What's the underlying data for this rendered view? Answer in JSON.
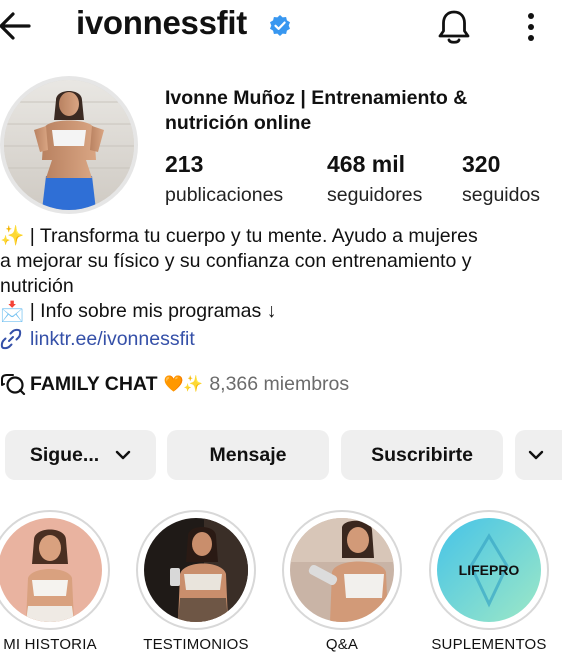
{
  "header": {
    "username": "ivonnessfit",
    "icons": {
      "back": "back-arrow-icon",
      "verified": "verified-badge-icon",
      "notifications": "bell-icon",
      "more": "more-vertical-icon"
    },
    "verified_color": "#3897f0"
  },
  "profile": {
    "display_name": "Ivonne Muñoz | Entrenamiento & nutrición online",
    "stats": [
      {
        "number": "213",
        "label": "publicaciones"
      },
      {
        "number": "468 mil",
        "label": "seguidores"
      },
      {
        "number": "320",
        "label": "seguidos"
      }
    ]
  },
  "bio": {
    "line1_emoji": "✨",
    "line1": " | Transforma tu cuerpo y tu mente. Ayudo a mujeres",
    "line2": "a mejorar su físico y su confianza con entrenamiento y",
    "line3": "nutrición",
    "line4_emoji": "📩",
    "line4": " | Info sobre mis programas ↓",
    "link": "linktr.ee/ivonnessfit",
    "link_color": "#3550a8"
  },
  "channel": {
    "name": "FAMILY CHAT",
    "emojis": "🧡✨",
    "members": "8,366 miembros"
  },
  "actions": {
    "follow": "Sigue...",
    "message": "Mensaje",
    "subscribe": "Suscribirte"
  },
  "highlights": [
    {
      "label": "MI HISTORIA"
    },
    {
      "label": "TESTIMONIOS"
    },
    {
      "label": "Q&A"
    },
    {
      "label": "SUPLEMENTOS",
      "logo_text": "LIFEPRO"
    }
  ]
}
